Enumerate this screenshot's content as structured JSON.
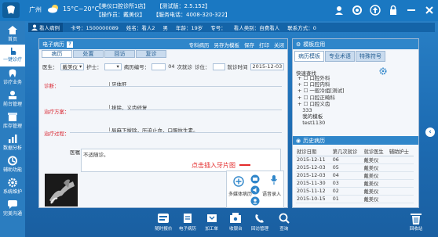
{
  "header": {
    "city": "广州",
    "temperature": "15°C~20°C",
    "clinic_name": "【美仪口腔诊所1店】",
    "test_version": "【测试版：2.5.152】",
    "operator": "【操作员：戴美仪】",
    "service_phone": "【服务电话：4008-320-322】"
  },
  "sidebar": {
    "items": [
      {
        "label": "首页",
        "icon": "home-icon"
      },
      {
        "label": "一键诊疗",
        "icon": "hand-icon",
        "active": true
      },
      {
        "label": "诊疗业务",
        "icon": "tooth-icon"
      },
      {
        "label": "前台管理",
        "icon": "desk-icon"
      },
      {
        "label": "库存管理",
        "icon": "box-icon"
      },
      {
        "label": "数据分析",
        "icon": "chart-icon"
      },
      {
        "label": "辅助功能",
        "icon": "tool-icon"
      },
      {
        "label": "系统维护",
        "icon": "gear-icon"
      },
      {
        "label": "完美沟通",
        "icon": "chat-icon"
      }
    ]
  },
  "patient": {
    "tag": "看人病例",
    "card_no": "卡号：1500000089",
    "name": "姓名：看人2",
    "sex": "男",
    "age": "年龄：19岁",
    "phone": "专号：",
    "category": "看人类别：自费看人",
    "contact": "联系方式：0"
  },
  "record": {
    "title": "电子病历",
    "help": "?",
    "actions": [
      "专科病历",
      "另存为模板",
      "保存",
      "打印",
      "关闭"
    ],
    "tabs": [
      "病历",
      "处置",
      "回访",
      "复诊"
    ],
    "form": {
      "doctor_label": "医生：",
      "doctor_value": "戴美仪",
      "nurse_label": "护士：",
      "nurse_value": "",
      "record_no_label": "病历编号：",
      "visit_count": "04",
      "visit_label": "次就诊",
      "type_label": "诊位：",
      "time_label": "就诊时间",
      "time_value": "2015-12-03"
    },
    "sections": [
      {
        "label": "诊断：",
        "value": "牙体肝"
      },
      {
        "label": "治疗方案：",
        "value": "拔除，义齿修复"
      },
      {
        "label": "治疗过程：",
        "value": "局麻下拔除，压迫止血，口服抗生素。"
      }
    ],
    "history_label": "医嘱：",
    "history_value": "不适随诊。",
    "media": {
      "mm_label": "多媒体病历",
      "voice_label": "语音录入"
    },
    "hint": "点击插入牙片图"
  },
  "right_panel": {
    "title": "模板应用",
    "tabs": [
      "病历模板",
      "专业术语",
      "特殊符号"
    ],
    "search_label": "快速查找",
    "tree": [
      "口腔外科",
      "口腔内科",
      "一般冷组[测试]",
      "口腔正畸科",
      "口腔义齿",
      "333",
      "我的模板",
      "test1130"
    ],
    "history_title": "历史病历",
    "history_columns": [
      "就诊日期",
      "第几次就诊",
      "就诊医生",
      "辅助护士"
    ],
    "history_rows": [
      [
        "2015-12-11",
        "06",
        "戴美仪",
        ""
      ],
      [
        "2015-12-03",
        "05",
        "戴美仪",
        ""
      ],
      [
        "2015-12-03",
        "04",
        "戴美仪",
        ""
      ],
      [
        "2015-11-30",
        "03",
        "戴美仪",
        ""
      ],
      [
        "2015-11-12",
        "02",
        "戴美仪",
        ""
      ],
      [
        "2015-10-15",
        "01",
        "戴美仪",
        ""
      ]
    ]
  },
  "dock": [
    {
      "label": "随时报价",
      "icon": "quote-icon"
    },
    {
      "label": "电子病历",
      "icon": "record-icon"
    },
    {
      "label": "加工单",
      "icon": "process-icon"
    },
    {
      "label": "收银台",
      "icon": "cashier-icon"
    },
    {
      "label": "回访管理",
      "icon": "callback-icon"
    },
    {
      "label": "查询",
      "icon": "query-icon"
    }
  ],
  "trash_label": "回收站"
}
